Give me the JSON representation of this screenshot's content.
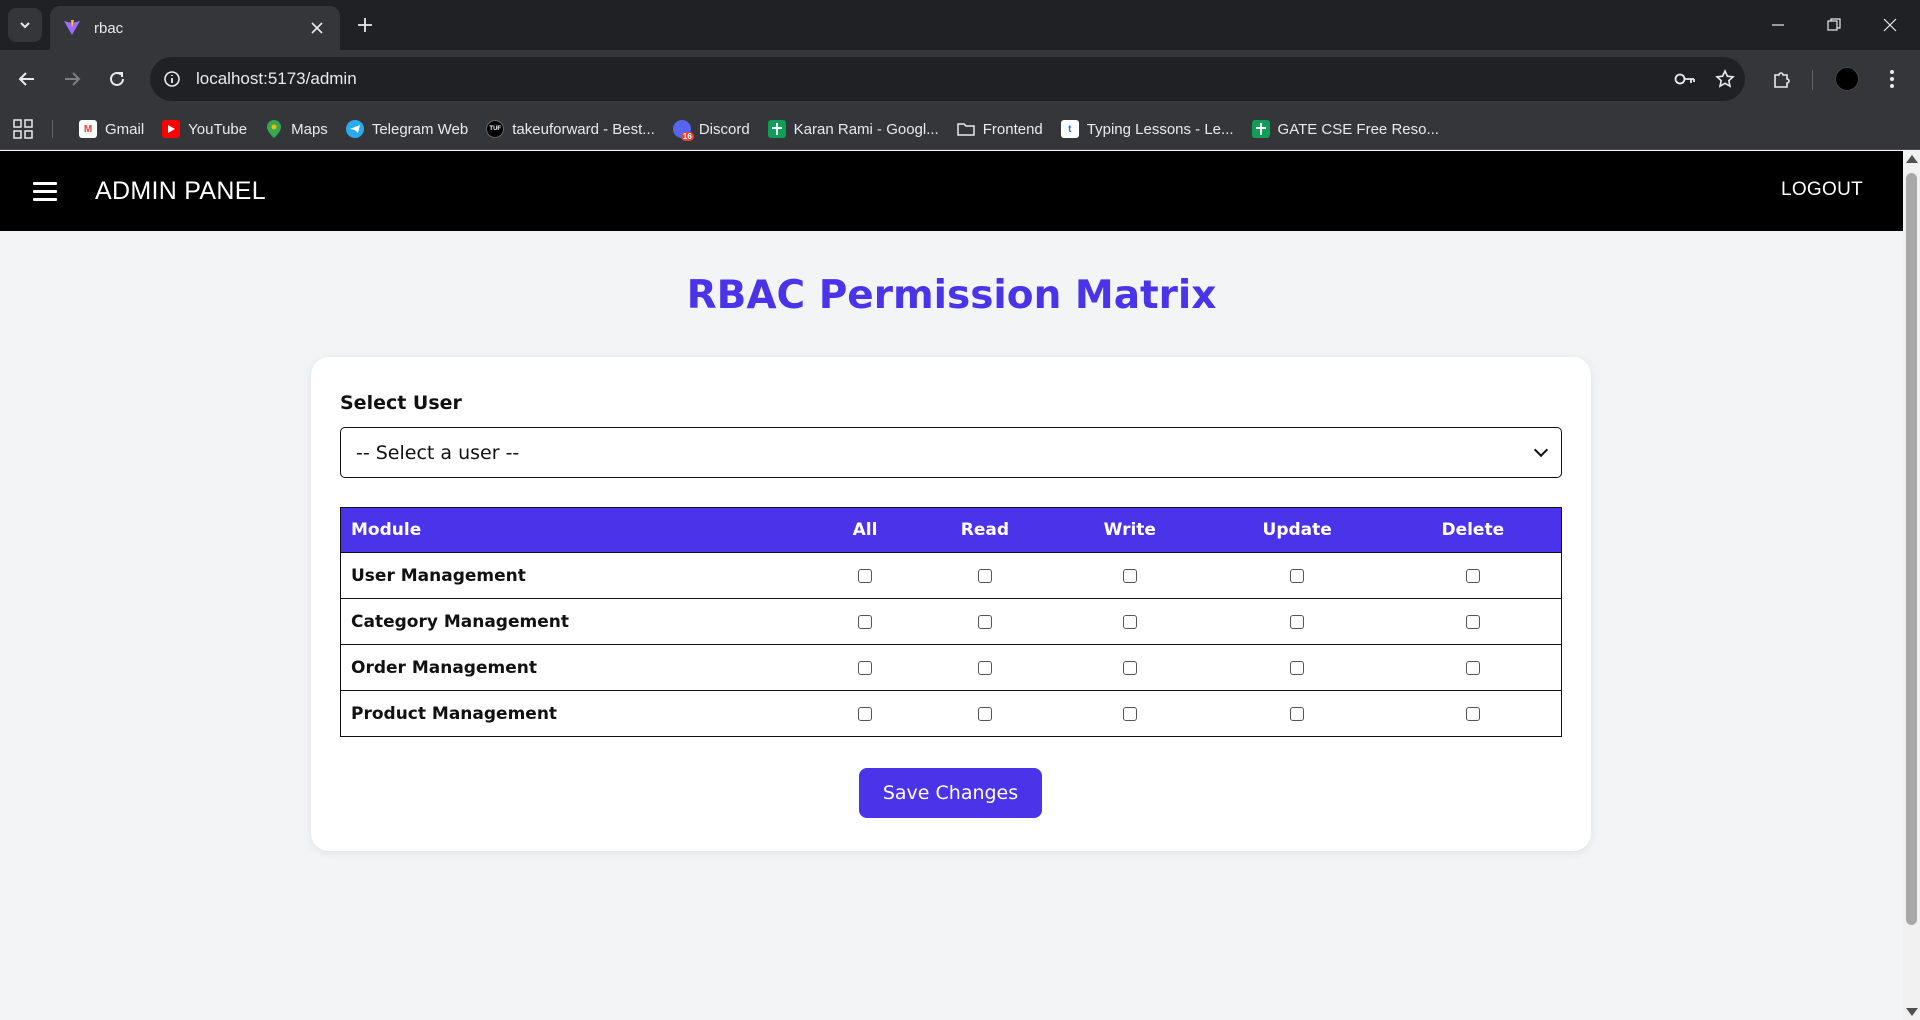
{
  "browser": {
    "tab_title": "rbac",
    "url": "localhost:5173/admin",
    "bookmarks": [
      {
        "label": "Gmail",
        "icon": "gmail-icon",
        "color": "#ea4335"
      },
      {
        "label": "YouTube",
        "icon": "youtube-icon",
        "color": "#ff0000"
      },
      {
        "label": "Maps",
        "icon": "maps-icon",
        "color": "#34a853"
      },
      {
        "label": "Telegram Web",
        "icon": "telegram-icon",
        "color": "#2aabee"
      },
      {
        "label": "takeuforward - Best...",
        "icon": "tuf-icon",
        "color": "#000000"
      },
      {
        "label": "Discord",
        "icon": "discord-icon",
        "color": "#5865f2"
      },
      {
        "label": "Karan Rami - Googl...",
        "icon": "sheets-icon",
        "color": "#0f9d58"
      },
      {
        "label": "Frontend",
        "icon": "folder-icon",
        "color": "#9aa0a6"
      },
      {
        "label": "Typing Lessons - Le...",
        "icon": "typing-icon",
        "color": "#1a73e8"
      },
      {
        "label": "GATE CSE Free Reso...",
        "icon": "sheets-icon",
        "color": "#0f9d58"
      }
    ]
  },
  "appbar": {
    "title": "ADMIN PANEL",
    "logout_label": "LOGOUT"
  },
  "page": {
    "heading": "RBAC Permission Matrix",
    "accent_color": "#4a33e8"
  },
  "form": {
    "select_label": "Select User",
    "select_value": "-- Select a user --"
  },
  "matrix": {
    "headers": [
      "Module",
      "All",
      "Read",
      "Write",
      "Update",
      "Delete"
    ],
    "rows": [
      {
        "module": "User Management",
        "all": false,
        "read": false,
        "write": false,
        "update": false,
        "delete": false
      },
      {
        "module": "Category Management",
        "all": false,
        "read": false,
        "write": false,
        "update": false,
        "delete": false
      },
      {
        "module": "Order Management",
        "all": false,
        "read": false,
        "write": false,
        "update": false,
        "delete": false
      },
      {
        "module": "Product Management",
        "all": false,
        "read": false,
        "write": false,
        "update": false,
        "delete": false
      }
    ]
  },
  "actions": {
    "save_label": "Save Changes"
  }
}
